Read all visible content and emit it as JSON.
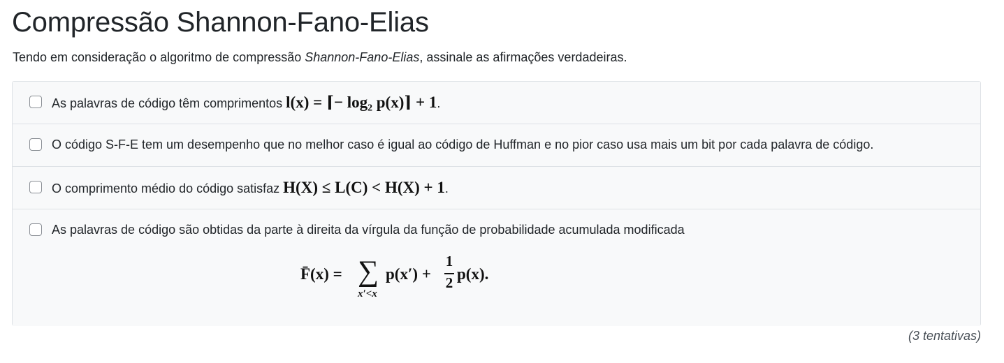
{
  "title": "Compressão Shannon-Fano-Elias",
  "description": {
    "before": "Tendo em consideração o algoritmo de compressão ",
    "emphasis": "Shannon-Fano-Elias",
    "after": ", assinale as afirmações verdadeiras."
  },
  "options": [
    {
      "text": "As palavras de código têm comprimentos ",
      "math": "l(x) = ⌈− log₂ p(x)⌉ + 1",
      "suffix": ".",
      "checked": false
    },
    {
      "text": "O código S-F-E tem um desempenho que no melhor caso é igual ao código de Huffman e no pior caso usa mais um bit por cada palavra de código.",
      "checked": false
    },
    {
      "text": "O comprimento médio do código satisfaz ",
      "math": "H(X) ≤ L(C) < H(X) + 1",
      "suffix": ".",
      "checked": false
    },
    {
      "text": "As palavras de código são obtidas da parte à direita da vírgula da função de probabilidade acumulada modificada",
      "display_math": {
        "lhs": "F̄(x) =",
        "sum": "∑",
        "sum_sub": "x′<x",
        "mid": "p(x′) +",
        "frac_num": "1",
        "frac_den": "2",
        "rhs": "p(x)."
      },
      "checked": false
    }
  ],
  "attempts": "(3 tentativas)"
}
